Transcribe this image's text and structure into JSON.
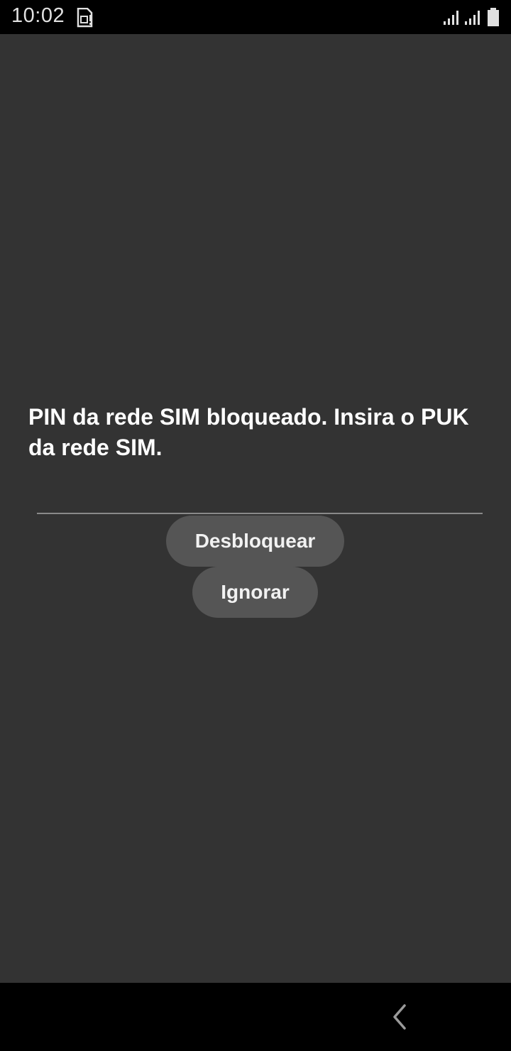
{
  "status_bar": {
    "time": "10:02",
    "icons": [
      "sim-card-alert-icon",
      "signal-icon",
      "signal-icon",
      "battery-icon"
    ]
  },
  "lock_screen": {
    "message": "PIN da rede SIM bloqueado. Insira o PUK da rede SIM.",
    "puk_input": {
      "value": "",
      "placeholder": ""
    },
    "unlock_label": "Desbloquear",
    "ignore_label": "Ignorar"
  },
  "nav_bar": {
    "icons": [
      "back-icon"
    ]
  },
  "colors": {
    "background": "#333333",
    "bars": "#000000",
    "button": "#555555",
    "text": "#ffffff",
    "underline": "#8a8a8a"
  }
}
